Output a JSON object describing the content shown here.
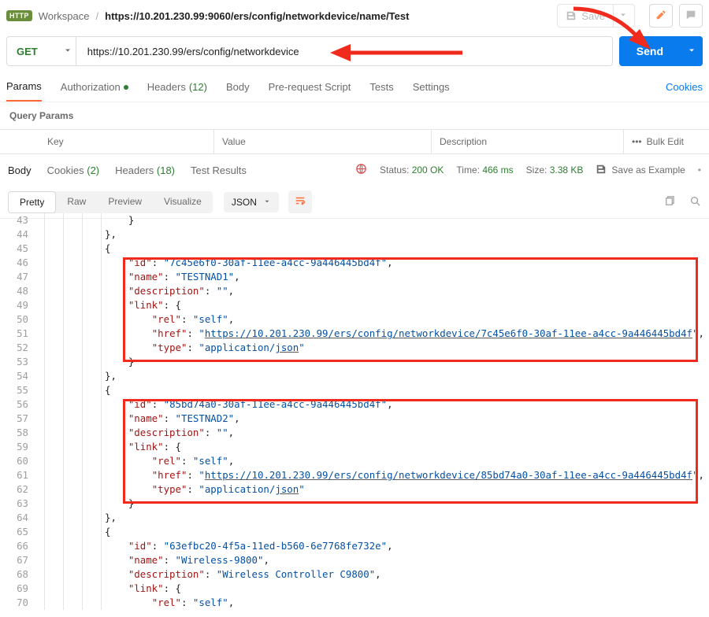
{
  "breadcrumb": {
    "badge": "HTTP",
    "workspace": "Workspace",
    "title": "https://10.201.230.99:9060/ers/config/networkdevice/name/Test"
  },
  "toolbar": {
    "save_label": "Save"
  },
  "request": {
    "method": "GET",
    "url": "https://10.201.230.99/ers/config/networkdevice",
    "send_label": "Send"
  },
  "tabs": {
    "params": "Params",
    "authorization": "Authorization",
    "headers_label": "Headers",
    "headers_count": "(12)",
    "body": "Body",
    "prerequest": "Pre-request Script",
    "tests": "Tests",
    "settings": "Settings",
    "cookies": "Cookies"
  },
  "query_params": {
    "heading": "Query Params",
    "key": "Key",
    "value": "Value",
    "description": "Description",
    "bulk_edit": "Bulk Edit"
  },
  "response_tabs": {
    "body": "Body",
    "cookies": "Cookies",
    "cookies_count": "(2)",
    "headers": "Headers",
    "headers_count": "(18)",
    "test_results": "Test Results",
    "status_label": "Status:",
    "status_value": "200 OK",
    "time_label": "Time:",
    "time_value": "466 ms",
    "size_label": "Size:",
    "size_value": "3.38 KB",
    "save_example": "Save as Example"
  },
  "view": {
    "pretty": "Pretty",
    "raw": "Raw",
    "preview": "Preview",
    "visualize": "Visualize",
    "format": "JSON"
  },
  "code": {
    "lines": [
      {
        "n": 43,
        "i": 4,
        "raw": "}"
      },
      {
        "n": 44,
        "i": 3,
        "raw": "},"
      },
      {
        "n": 45,
        "i": 3,
        "raw": "{"
      },
      {
        "n": 46,
        "i": 4,
        "kv": {
          "k": "id",
          "v": "7c45e6f0-30af-11ee-a4cc-9a446445bd4f",
          "c": true
        }
      },
      {
        "n": 47,
        "i": 4,
        "kv": {
          "k": "name",
          "v": "TESTNAD1",
          "c": true
        }
      },
      {
        "n": 48,
        "i": 4,
        "kv": {
          "k": "description",
          "v": "",
          "c": true
        }
      },
      {
        "n": 49,
        "i": 4,
        "kopen": {
          "k": "link"
        }
      },
      {
        "n": 50,
        "i": 5,
        "kv": {
          "k": "rel",
          "v": "self",
          "c": true
        }
      },
      {
        "n": 51,
        "i": 5,
        "kv": {
          "k": "href",
          "v": "https://10.201.230.99/ers/config/networkdevice/7c45e6f0-30af-11ee-a4cc-9a446445bd4f",
          "c": true,
          "u": true
        }
      },
      {
        "n": 52,
        "i": 5,
        "kv": {
          "k": "type",
          "v": "application/json",
          "c": false,
          "u2": "json"
        }
      },
      {
        "n": 53,
        "i": 4,
        "raw": "}"
      },
      {
        "n": 54,
        "i": 3,
        "raw": "},"
      },
      {
        "n": 55,
        "i": 3,
        "raw": "{"
      },
      {
        "n": 56,
        "i": 4,
        "kv": {
          "k": "id",
          "v": "85bd74a0-30af-11ee-a4cc-9a446445bd4f",
          "c": true
        }
      },
      {
        "n": 57,
        "i": 4,
        "kv": {
          "k": "name",
          "v": "TESTNAD2",
          "c": true
        }
      },
      {
        "n": 58,
        "i": 4,
        "kv": {
          "k": "description",
          "v": "",
          "c": true
        }
      },
      {
        "n": 59,
        "i": 4,
        "kopen": {
          "k": "link"
        }
      },
      {
        "n": 60,
        "i": 5,
        "kv": {
          "k": "rel",
          "v": "self",
          "c": true
        }
      },
      {
        "n": 61,
        "i": 5,
        "kv": {
          "k": "href",
          "v": "https://10.201.230.99/ers/config/networkdevice/85bd74a0-30af-11ee-a4cc-9a446445bd4f",
          "c": true,
          "u": true
        }
      },
      {
        "n": 62,
        "i": 5,
        "kv": {
          "k": "type",
          "v": "application/json",
          "c": false,
          "u2": "json"
        }
      },
      {
        "n": 63,
        "i": 4,
        "raw": "}"
      },
      {
        "n": 64,
        "i": 3,
        "raw": "},"
      },
      {
        "n": 65,
        "i": 3,
        "raw": "{"
      },
      {
        "n": 66,
        "i": 4,
        "kv": {
          "k": "id",
          "v": "63efbc20-4f5a-11ed-b560-6e7768fe732e",
          "c": true
        }
      },
      {
        "n": 67,
        "i": 4,
        "kv": {
          "k": "name",
          "v": "Wireless-9800",
          "c": true
        }
      },
      {
        "n": 68,
        "i": 4,
        "kv": {
          "k": "description",
          "v": "Wireless Controller C9800",
          "c": true
        }
      },
      {
        "n": 69,
        "i": 4,
        "kopen": {
          "k": "link"
        }
      },
      {
        "n": 70,
        "i": 5,
        "kv": {
          "k": "rel",
          "v": "self",
          "c": true
        }
      }
    ]
  }
}
